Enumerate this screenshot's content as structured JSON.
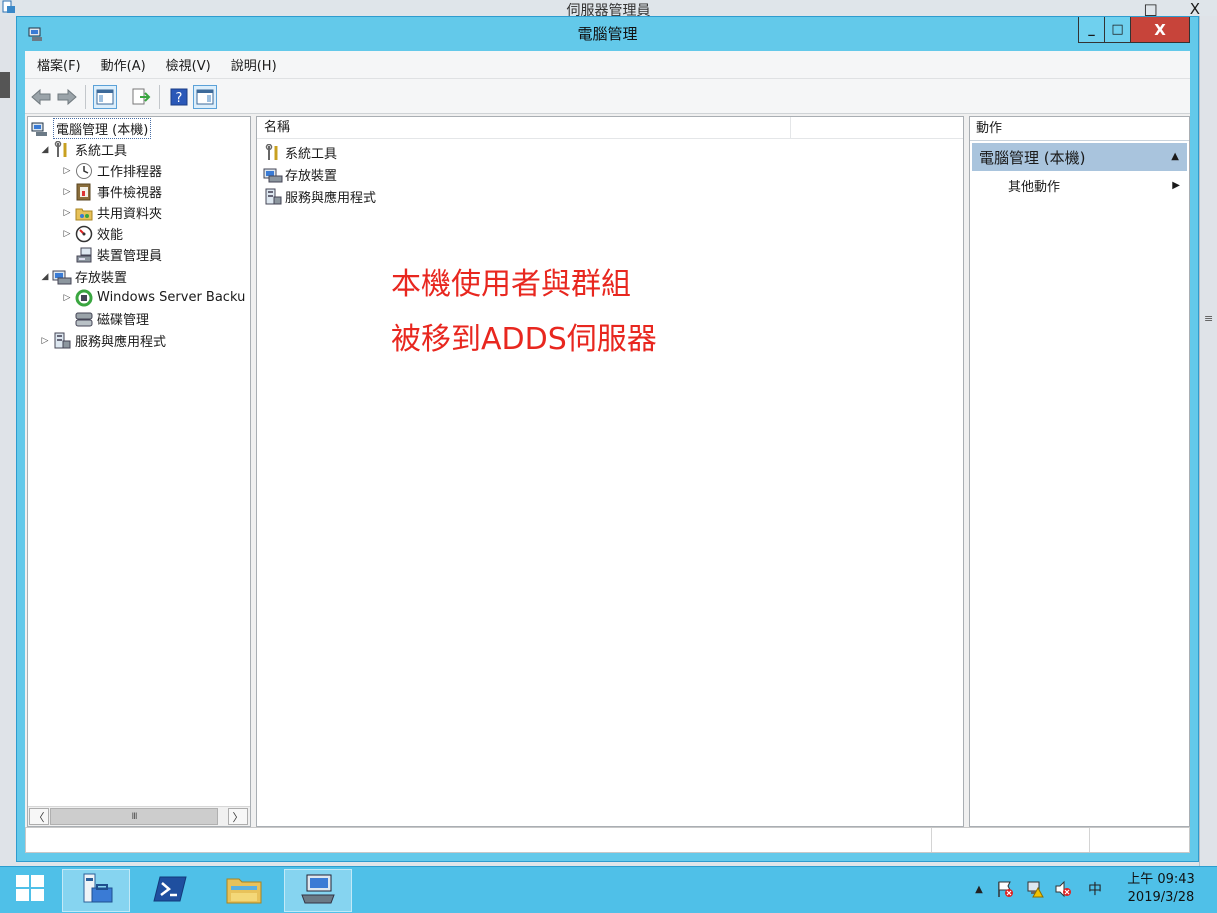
{
  "background_window": {
    "title": "伺服器管理員",
    "controls": [
      "_",
      "□",
      "X"
    ]
  },
  "window": {
    "title": "電腦管理",
    "controls": {
      "minimize": "_",
      "maximize": "□",
      "close": "X"
    }
  },
  "menu": [
    {
      "label": "檔案(F)"
    },
    {
      "label": "動作(A)"
    },
    {
      "label": "檢視(V)"
    },
    {
      "label": "說明(H)"
    }
  ],
  "toolbar": {
    "buttons": [
      "back-icon",
      "forward-icon",
      "show-hide-tree-icon",
      "export-list-icon",
      "help-icon",
      "show-hide-action-pane-icon"
    ]
  },
  "tree": {
    "root": "電腦管理 (本機)",
    "items": [
      {
        "label": "系統工具",
        "expander": "◢",
        "icon": "system-tools-icon"
      },
      {
        "label": "工作排程器",
        "expander": "▷",
        "icon": "task-scheduler-icon"
      },
      {
        "label": "事件檢視器",
        "expander": "▷",
        "icon": "event-viewer-icon"
      },
      {
        "label": "共用資料夾",
        "expander": "▷",
        "icon": "shared-folders-icon"
      },
      {
        "label": "效能",
        "expander": "▷",
        "icon": "performance-icon"
      },
      {
        "label": "裝置管理員",
        "expander": "",
        "icon": "device-manager-icon"
      },
      {
        "label": "存放裝置",
        "expander": "◢",
        "icon": "storage-icon"
      },
      {
        "label": "Windows Server Backu",
        "expander": "▷",
        "icon": "windows-server-backup-icon"
      },
      {
        "label": "磁碟管理",
        "expander": "",
        "icon": "disk-management-icon"
      },
      {
        "label": "服務與應用程式",
        "expander": "▷",
        "icon": "services-apps-icon"
      }
    ],
    "scroll_thumb": "III"
  },
  "list": {
    "column_header": "名稱",
    "rows": [
      {
        "label": "系統工具",
        "icon": "system-tools-icon"
      },
      {
        "label": "存放裝置",
        "icon": "storage-icon"
      },
      {
        "label": "服務與應用程式",
        "icon": "services-apps-icon"
      }
    ],
    "annotation": [
      "本機使用者與群組",
      "被移到ADDS伺服器"
    ]
  },
  "actions": {
    "header": "動作",
    "section": "電腦管理 (本機)",
    "item": "其他動作"
  },
  "taskbar": {
    "apps": [
      "server-manager-icon",
      "powershell-icon",
      "file-explorer-icon",
      "computer-management-icon"
    ],
    "tray": {
      "ime": "中",
      "time": "上午 09:43",
      "date": "2019/3/28"
    }
  },
  "colors": {
    "title_bar": "#63c9ea",
    "taskbar": "#4fc0e8",
    "close_button": "#c7443a",
    "annotation_text": "#e8271f",
    "action_section_bg": "#a9c4dd"
  }
}
